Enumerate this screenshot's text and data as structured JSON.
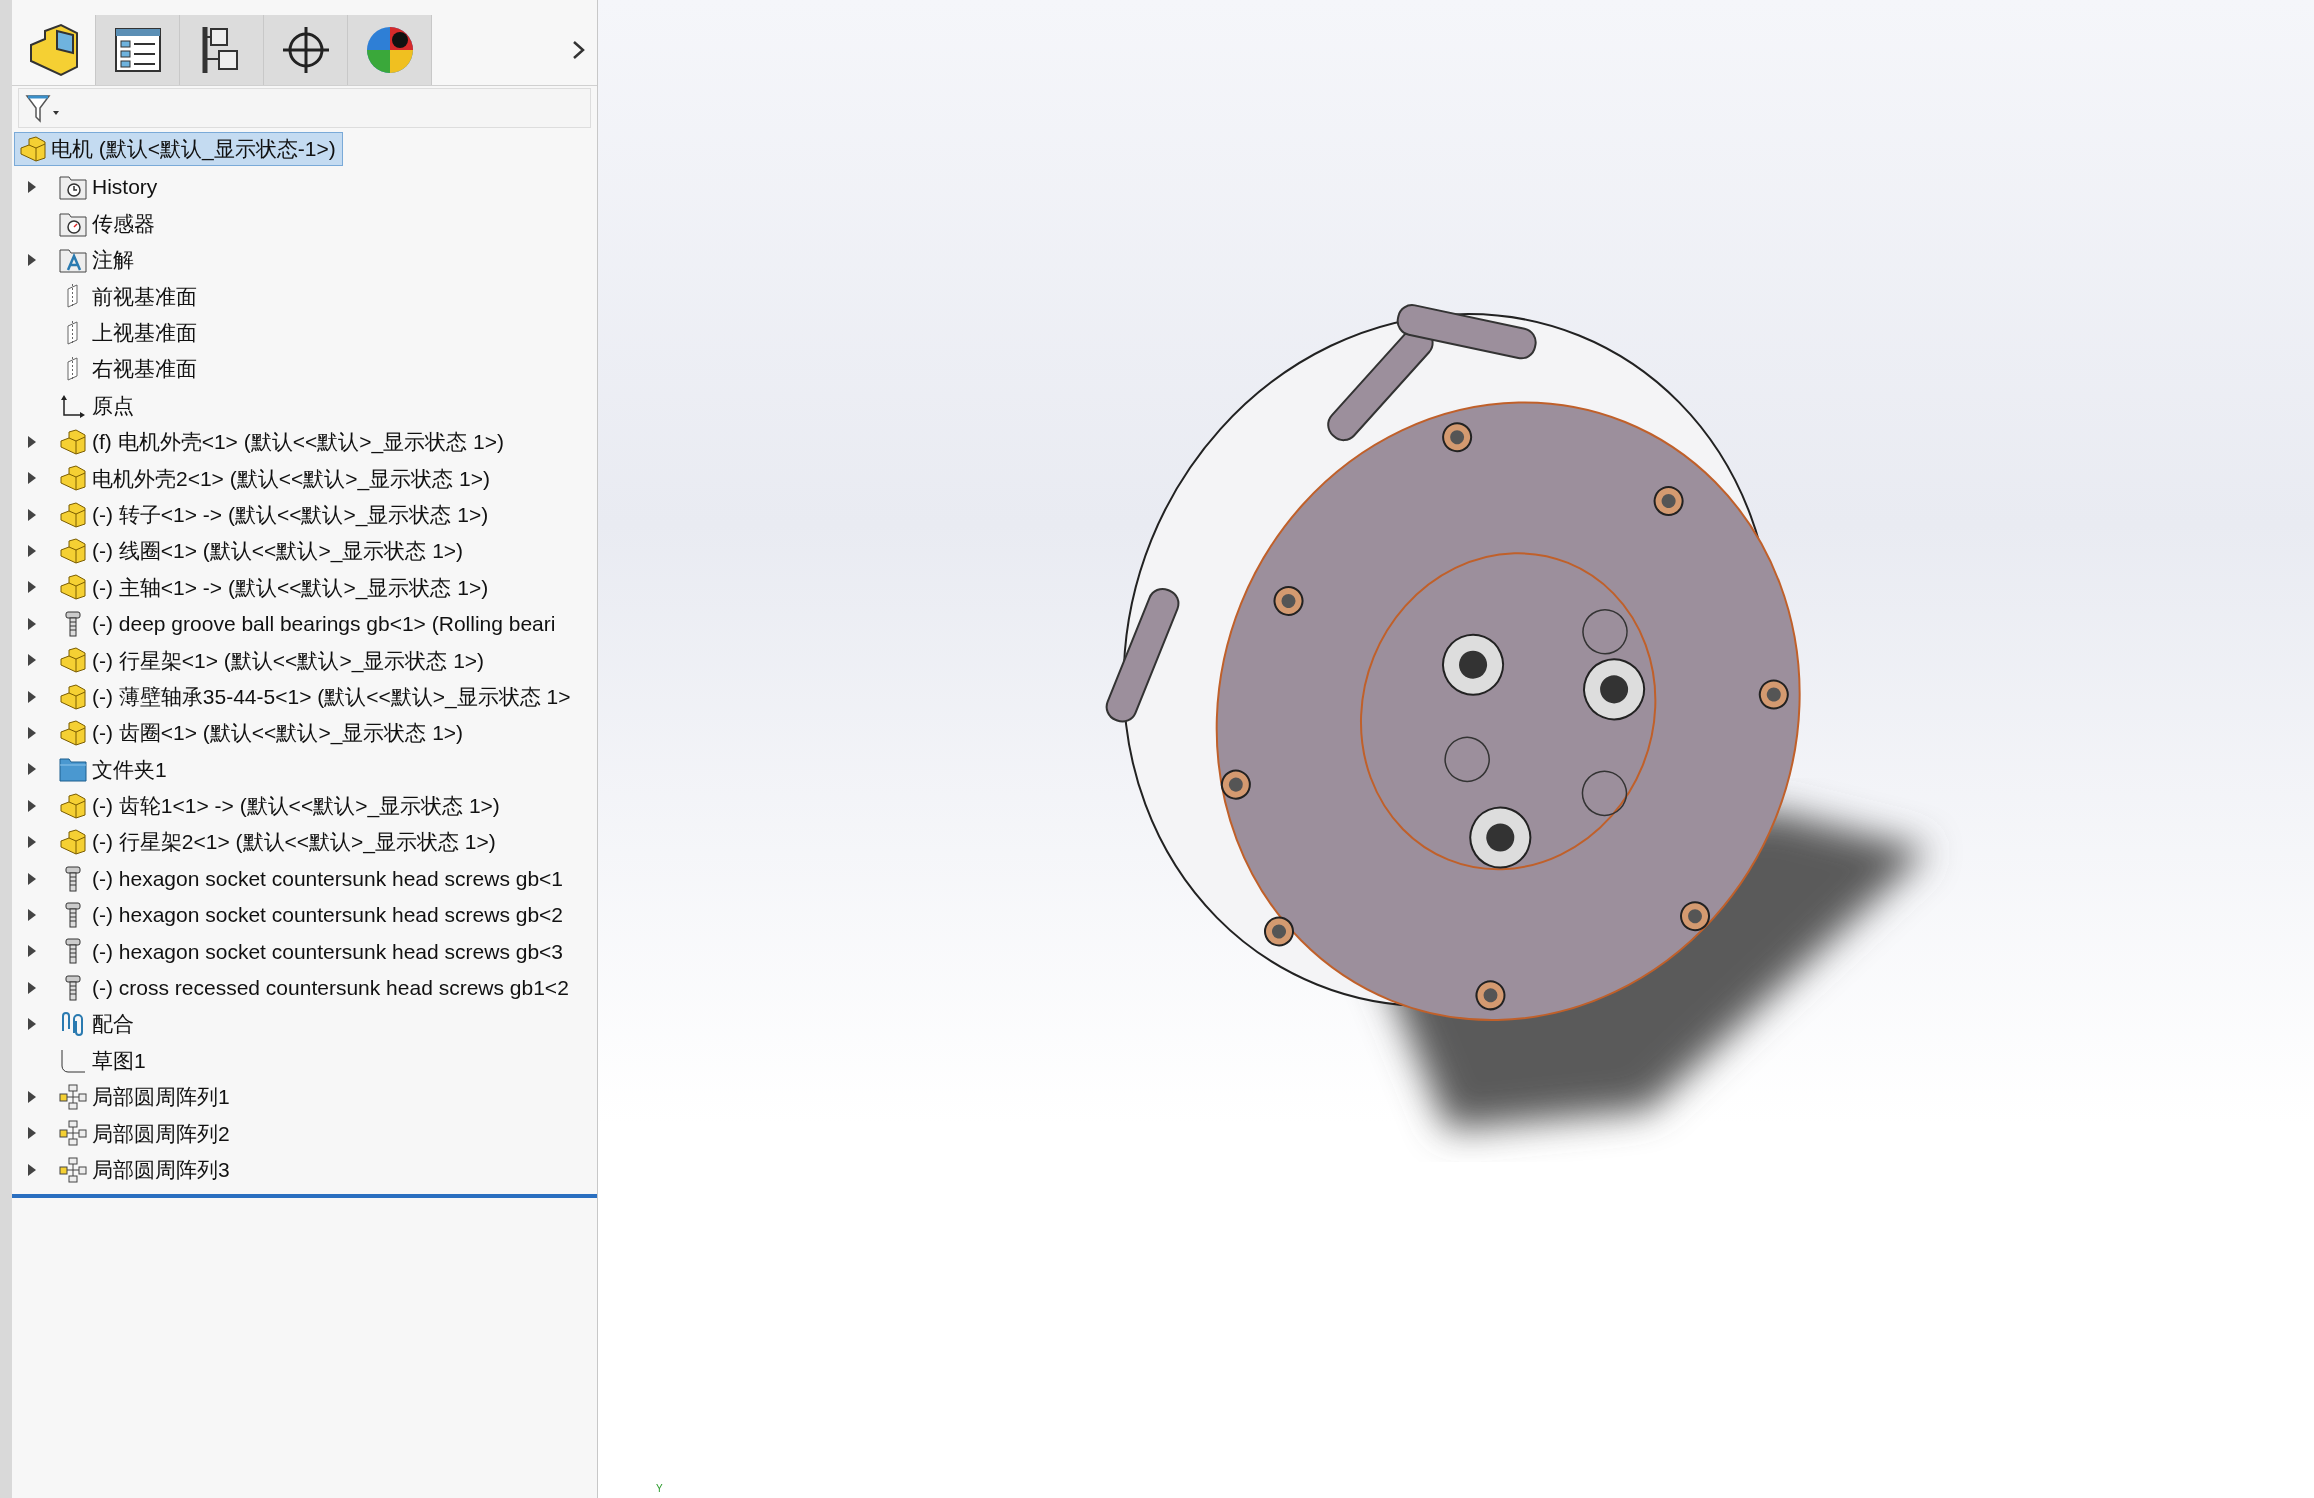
{
  "tabs": [
    {
      "kind": "feature-tree",
      "selected": true
    },
    {
      "kind": "property",
      "selected": false
    },
    {
      "kind": "configuration",
      "selected": false
    },
    {
      "kind": "dimxpert",
      "selected": false
    },
    {
      "kind": "display",
      "selected": false
    }
  ],
  "tree": {
    "root": {
      "label": "电机 (默认<默认_显示状态-1>)",
      "selected": true
    },
    "items": [
      {
        "kind": "history",
        "label": "History",
        "expandable": true
      },
      {
        "kind": "sensor",
        "label": "传感器",
        "expandable": false
      },
      {
        "kind": "annotation",
        "label": "注解",
        "expandable": true
      },
      {
        "kind": "plane",
        "label": "前视基准面",
        "expandable": false
      },
      {
        "kind": "plane",
        "label": "上视基准面",
        "expandable": false
      },
      {
        "kind": "plane",
        "label": "右视基准面",
        "expandable": false
      },
      {
        "kind": "origin",
        "label": "原点",
        "expandable": false
      },
      {
        "kind": "part",
        "label": "(f) 电机外壳<1> (默认<<默认>_显示状态 1>)",
        "expandable": true
      },
      {
        "kind": "part",
        "label": "电机外壳2<1> (默认<<默认>_显示状态 1>)",
        "expandable": true
      },
      {
        "kind": "part",
        "label": "(-) 转子<1> -> (默认<<默认>_显示状态 1>)",
        "expandable": true
      },
      {
        "kind": "part",
        "label": "(-) 线圈<1> (默认<<默认>_显示状态 1>)",
        "expandable": true
      },
      {
        "kind": "part",
        "label": "(-) 主轴<1> -> (默认<<默认>_显示状态 1>)",
        "expandable": true
      },
      {
        "kind": "fastener",
        "label": "(-) deep groove ball bearings gb<1> (Rolling beari",
        "expandable": true
      },
      {
        "kind": "part",
        "label": "(-) 行星架<1> (默认<<默认>_显示状态 1>)",
        "expandable": true
      },
      {
        "kind": "part",
        "label": "(-) 薄壁轴承35-44-5<1> (默认<<默认>_显示状态 1>",
        "expandable": true
      },
      {
        "kind": "part",
        "label": "(-) 齿圈<1> (默认<<默认>_显示状态 1>)",
        "expandable": true
      },
      {
        "kind": "folder",
        "label": "文件夹1",
        "expandable": true
      },
      {
        "kind": "part",
        "label": "(-) 齿轮1<1> -> (默认<<默认>_显示状态 1>)",
        "expandable": true
      },
      {
        "kind": "part",
        "label": "(-) 行星架2<1> (默认<<默认>_显示状态 1>)",
        "expandable": true
      },
      {
        "kind": "fastener",
        "label": "(-) hexagon socket countersunk head screws gb<1",
        "expandable": true
      },
      {
        "kind": "fastener",
        "label": "(-) hexagon socket countersunk head screws gb<2",
        "expandable": true
      },
      {
        "kind": "fastener",
        "label": "(-) hexagon socket countersunk head screws gb<3",
        "expandable": true
      },
      {
        "kind": "fastener",
        "label": "(-) cross recessed countersunk head screws gb1<2",
        "expandable": true
      },
      {
        "kind": "mates",
        "label": "配合",
        "expandable": true
      },
      {
        "kind": "sketch",
        "label": "草图1",
        "expandable": false
      },
      {
        "kind": "pattern",
        "label": "局部圆周阵列1",
        "expandable": true
      },
      {
        "kind": "pattern",
        "label": "局部圆周阵列2",
        "expandable": true
      },
      {
        "kind": "pattern",
        "label": "局部圆周阵列3",
        "expandable": true
      }
    ]
  },
  "viewport": {
    "triad_label": "Y"
  }
}
